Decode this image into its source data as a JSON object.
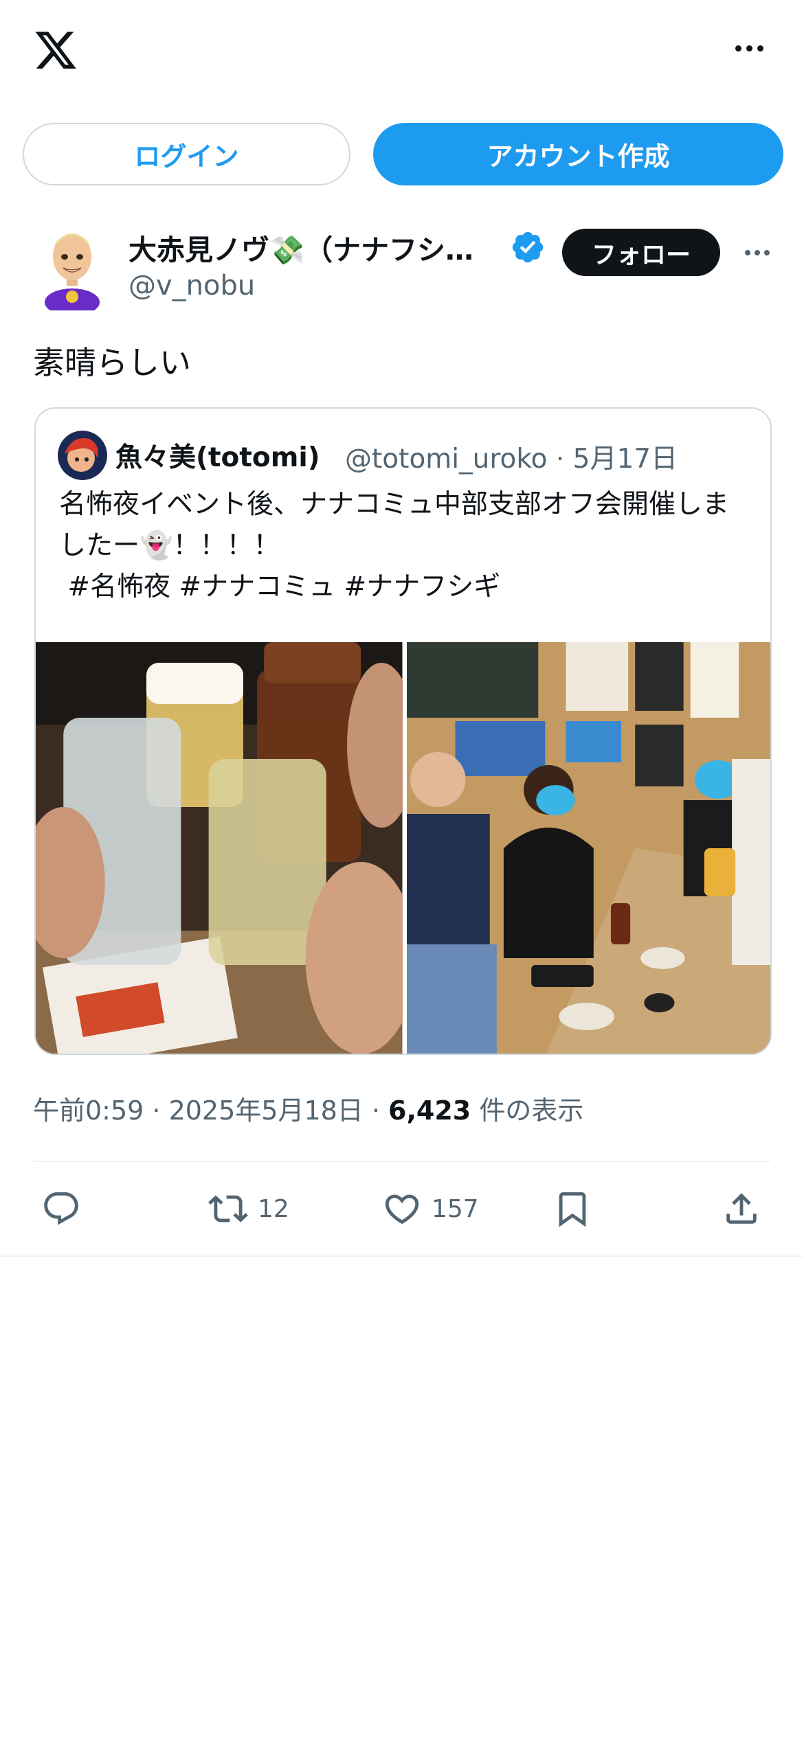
{
  "header": {
    "logo_icon": "x-logo-icon",
    "more_icon": "more-icon"
  },
  "auth": {
    "login_label": "ログイン",
    "signup_label": "アカウント作成"
  },
  "post": {
    "author_name": "大赤見ノヴ💸（ナナフシ…",
    "author_handle": "@v_nobu",
    "verified": true,
    "follow_label": "フォロー",
    "text": "素晴らしい",
    "timestamp": "午前0:59 · 2025年5月18日 · ",
    "views_count": "6,423",
    "views_label": " 件の表示"
  },
  "quote": {
    "author_name": "魚々美(totomi)",
    "author_handle": "@totomi_uroko · 5月17日",
    "text": "名怖夜イベント後、ナナコミュ中部支部オフ会開催しましたー👻！！！！\n #名怖夜 #ナナコミュ #ナナフシギ",
    "media": [
      "photo-toast",
      "photo-group"
    ]
  },
  "actions": {
    "reply_count": "",
    "retweet_count": "12",
    "like_count": "157",
    "bookmark_icon": "bookmark-icon",
    "share_icon": "share-icon"
  },
  "colors": {
    "accent": "#1d9bf0",
    "text": "#0f1419",
    "muted": "#536471",
    "border": "#cfd9de"
  }
}
